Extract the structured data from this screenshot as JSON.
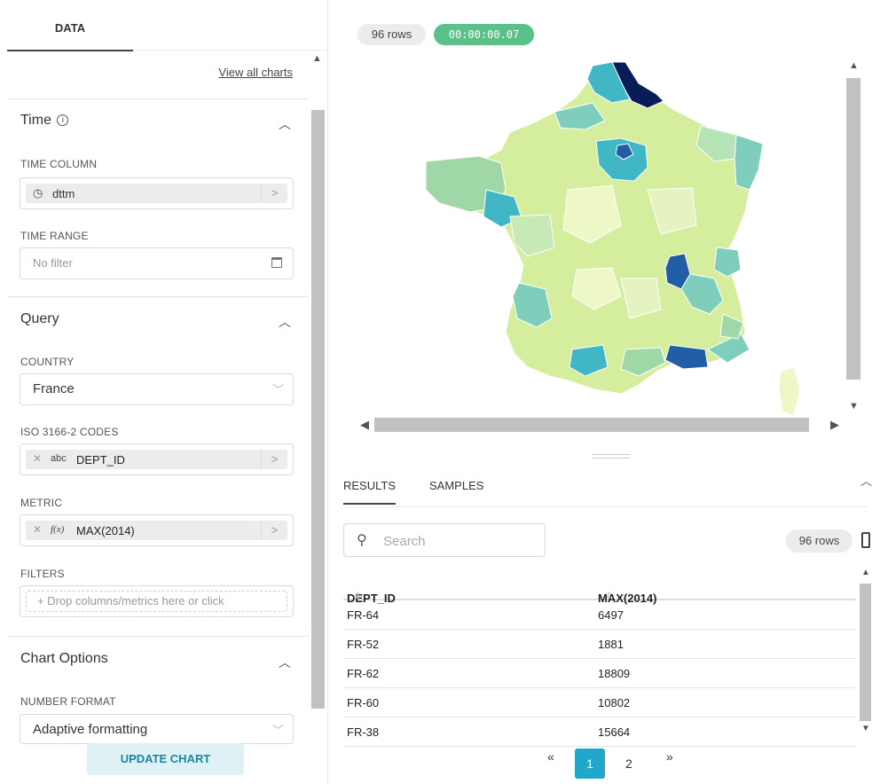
{
  "left_panel": {
    "tab_label": "DATA",
    "view_all_link": "View all charts",
    "time_section": {
      "title": "Time",
      "info_icon": "info-icon",
      "time_column_label": "TIME COLUMN",
      "time_column_value": "dttm",
      "time_range_label": "TIME RANGE",
      "time_range_placeholder": "No filter"
    },
    "query_section": {
      "title": "Query",
      "country_label": "COUNTRY",
      "country_value": "France",
      "iso_label": "ISO 3166-2 CODES",
      "iso_type": "abc",
      "iso_value": "DEPT_ID",
      "metric_label": "METRIC",
      "metric_type": "f(x)",
      "metric_value": "MAX(2014)",
      "filters_label": "FILTERS",
      "filters_placeholder": "+ Drop columns/metrics here or click"
    },
    "chart_options": {
      "title": "Chart Options",
      "number_format_label": "NUMBER FORMAT",
      "number_format_value": "Adaptive formatting"
    },
    "update_button": "UPDATE CHART"
  },
  "chart_header": {
    "row_count": "96 rows",
    "elapsed": "00:00:00.07",
    "elapsed_color": "#5ac189"
  },
  "map_legend_colors": {
    "low": "#eef7c6",
    "mid_low": "#c7e9b4",
    "mid": "#7fcdbb",
    "mid_high": "#41b6c4",
    "high": "#225ea8",
    "max": "#081d58"
  },
  "results": {
    "tabs": [
      "RESULTS",
      "SAMPLES"
    ],
    "search_placeholder": "Search",
    "row_count": "96 rows",
    "columns": [
      "DEPT_ID",
      "MAX(2014)"
    ],
    "rows": [
      [
        "FR-64",
        "6497"
      ],
      [
        "FR-52",
        "1881"
      ],
      [
        "FR-62",
        "18809"
      ],
      [
        "FR-60",
        "10802"
      ],
      [
        "FR-38",
        "15664"
      ]
    ],
    "pagination": {
      "prev": "«",
      "pages": [
        "1",
        "2"
      ],
      "active": "1",
      "next": "»"
    }
  }
}
